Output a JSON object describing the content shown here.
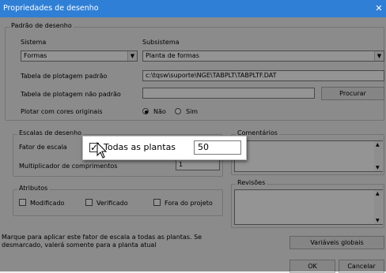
{
  "window": {
    "title": "Propriedades de desenho"
  },
  "padrao": {
    "group_label": "Padrão de desenho",
    "sistema_label": "Sistema",
    "sistema_value": "Formas",
    "subsistema_label": "Subsistema",
    "subsistema_value": "Planta de formas",
    "tabela_padrao_label": "Tabela de plotagem padrão",
    "tabela_padrao_value": "c:\\tqsw\\suporte\\NGE\\TABPLT\\TABPLTF.DAT",
    "tabela_nao_padrao_label": "Tabela de plotagem não padrão",
    "tabela_nao_padrao_value": "",
    "procurar_label": "Procurar",
    "plotar_label": "Plotar com cores originais",
    "nao_label": "Não",
    "sim_label": "Sim"
  },
  "escalas": {
    "group_label": "Escalas de desenho",
    "fator_label": "Fator de escala",
    "mult_label": "Multiplicador de comprimentos",
    "mult_value": "1"
  },
  "atributos": {
    "group_label": "Atributos",
    "modificado": "Modificado",
    "verificado": "Verificado",
    "fora": "Fora do projeto"
  },
  "comentarios": {
    "group_label": "Comentários"
  },
  "revisoes": {
    "group_label": "Revisões"
  },
  "hint": "Marque para aplicar este fator de escala a todas as plantas. Se desmarcado, valerá somente para a planta atual",
  "buttons": {
    "variaveis": "Variáveis globais",
    "ok": "OK",
    "cancelar": "Cancelar"
  },
  "popup": {
    "checkbox_label": "Todas as plantas",
    "checked": true,
    "value": "50"
  },
  "colors": {
    "titlebar": "#2f7fd6",
    "overlay": "rgba(0,0,0,0.42)"
  }
}
